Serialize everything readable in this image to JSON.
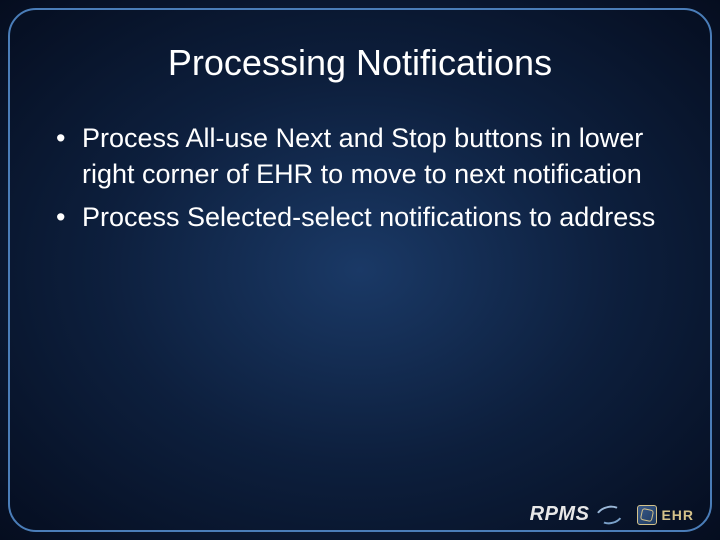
{
  "title": "Processing Notifications",
  "bullets": [
    "Process All-use Next and Stop buttons in lower right corner of EHR to move to next notification",
    "Process Selected-select notifications to address"
  ],
  "footer": {
    "rpms_label": "RPMS",
    "ehr_label": "EHR"
  }
}
